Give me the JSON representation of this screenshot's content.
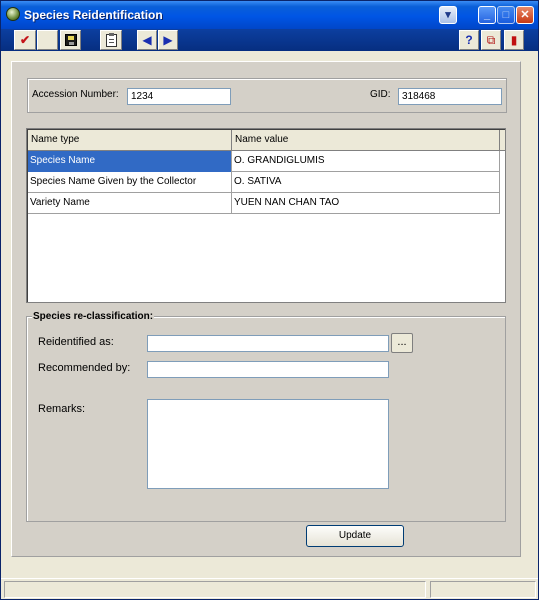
{
  "window": {
    "title": "Species Reidentification",
    "icon": "app-icon",
    "controls": [
      "dropdown",
      "minimize",
      "maximize",
      "close"
    ]
  },
  "toolbar": {
    "check_icon": "✔",
    "prev_icon": "◀",
    "next_icon": "▶",
    "help_icon": "?",
    "copy_icon": "⧉",
    "exit_icon": "▮"
  },
  "identity": {
    "accession_label": "Accession Number:",
    "accession_value": "1234",
    "gid_label": "GID:",
    "gid_value": "318468"
  },
  "names_grid": {
    "columns": [
      "Name type",
      "Name value"
    ],
    "rows": [
      {
        "type": "Species Name",
        "value": "O. GRANDIGLUMIS",
        "selected": true
      },
      {
        "type": "Species Name Given by the Collector",
        "value": "O. SATIVA",
        "selected": false
      },
      {
        "type": "Variety Name",
        "value": "YUEN NAN CHAN TAO",
        "selected": false
      }
    ]
  },
  "reclassification": {
    "title": "Species re-classification:",
    "reidentified_label": "Reidentified as:",
    "reidentified_value": "",
    "browse_label": "...",
    "recommended_label": "Recommended by:",
    "recommended_value": "",
    "remarks_label": "Remarks:",
    "remarks_value": ""
  },
  "actions": {
    "update_label": "Update"
  },
  "colors": {
    "title_bar": "#0055e5",
    "selection": "#316ac5",
    "panel": "#d4d0c8"
  }
}
